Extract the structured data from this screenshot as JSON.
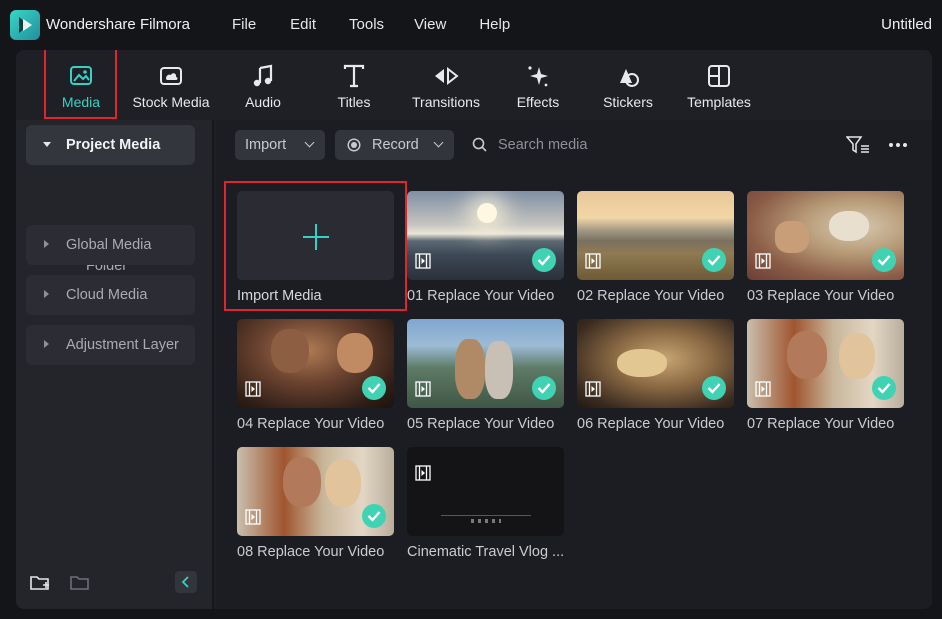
{
  "app": {
    "name": "Wondershare Filmora",
    "document_title": "Untitled"
  },
  "menu": [
    "File",
    "Edit",
    "Tools",
    "View",
    "Help"
  ],
  "toolbar": [
    {
      "label": "Media",
      "icon": "media-icon",
      "active": true
    },
    {
      "label": "Stock Media",
      "icon": "stock-media-icon"
    },
    {
      "label": "Audio",
      "icon": "music-note-icon"
    },
    {
      "label": "Titles",
      "icon": "text-t-icon"
    },
    {
      "label": "Transitions",
      "icon": "transitions-icon"
    },
    {
      "label": "Effects",
      "icon": "sparkle-icon"
    },
    {
      "label": "Stickers",
      "icon": "sticker-icon"
    },
    {
      "label": "Templates",
      "icon": "template-icon"
    }
  ],
  "sidebar": {
    "items": [
      {
        "label": "Project Media",
        "expanded": true
      },
      {
        "label": "Folder"
      },
      {
        "label": "Global Media"
      },
      {
        "label": "Cloud Media"
      },
      {
        "label": "Adjustment Layer"
      }
    ]
  },
  "controls": {
    "import_label": "Import",
    "record_label": "Record",
    "search_placeholder": "Search media"
  },
  "media": {
    "import_label": "Import Media",
    "items": [
      "01 Replace Your Video",
      "02 Replace Your Video",
      "03 Replace Your Video",
      "04 Replace Your Video",
      "05 Replace Your Video",
      "06 Replace Your Video",
      "07 Replace Your Video",
      "08 Replace Your Video",
      "Cinematic Travel Vlog ..."
    ]
  },
  "colors": {
    "accent": "#36d1c4",
    "check": "#3fd3b4",
    "highlight": "#e0252f"
  }
}
